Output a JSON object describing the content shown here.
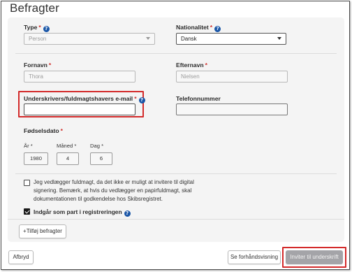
{
  "page_title": "Befragter",
  "type_field": {
    "label": "Type",
    "required_mark": "*",
    "value": "Person"
  },
  "nationality_field": {
    "label": "Nationalitet",
    "required_mark": "*",
    "value": "Dansk"
  },
  "firstname_field": {
    "label": "Fornavn",
    "required_mark": "*",
    "value": "Thora"
  },
  "lastname_field": {
    "label": "Efternavn",
    "required_mark": "*",
    "value": "Nielsen"
  },
  "email_field": {
    "label": "Underskrivers/fuldmagtshavers e-mail",
    "required_mark": "*",
    "value": ""
  },
  "phone_field": {
    "label": "Telefonnummer",
    "value": ""
  },
  "birthdate": {
    "label": "Fødselsdato",
    "required_mark": "*",
    "year": {
      "label": "År",
      "required_mark": "*",
      "value": "1980"
    },
    "month": {
      "label": "Måned",
      "required_mark": "*",
      "value": "4"
    },
    "day": {
      "label": "Dag",
      "required_mark": "*",
      "value": "6"
    }
  },
  "power_of_attorney_checkbox": {
    "checked": false,
    "line1": "Jeg vedlægger fuldmagt, da det ikke er muligt at invitere til digital",
    "line2": "signering. Bemærk, at hvis du vedlægger en papirfuldmagt, skal",
    "line3": "dokumentationen til godkendelse hos Skibsregistret."
  },
  "party_checkbox": {
    "checked": true,
    "label": "Indgår som part i registreringen"
  },
  "add_respondent_button": "+Tilføj befragter",
  "footer": {
    "cancel": "Afbryd",
    "preview": "Se forhåndsvisning",
    "invite": "Inviter til underskrift"
  },
  "colors": {
    "required": "#d0312d",
    "help_icon": "#1a56a7",
    "highlight": "#d32a2a",
    "primary_disabled": "#a4a4a8"
  }
}
